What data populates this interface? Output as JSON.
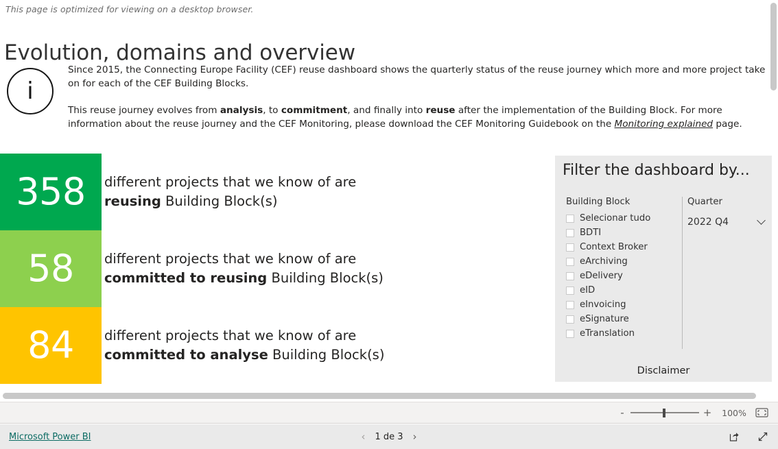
{
  "notice": "This page is optimized for viewing on a desktop browser.",
  "page_title": "Evolution, domains and overview",
  "info": {
    "icon": "info-circle-icon",
    "glyph": "i",
    "paragraph_1_a": "Since 2015, the Connecting Europe Facility (CEF) reuse dashboard shows the quarterly status of the reuse journey which more and more project take on for each of the CEF Building Blocks.",
    "paragraph_2_a": "This reuse journey evolves from ",
    "p2_bold_1": "analysis",
    "paragraph_2_b": ", to ",
    "p2_bold_2": "commitment",
    "paragraph_2_c": ", and finally into ",
    "p2_bold_3": "reuse",
    "paragraph_2_d": " after the implementation of the Building Block. For more information about the reuse journey and the CEF Monitoring, please download the CEF Monitoring Guidebook on the ",
    "link_text": "Monitoring explained",
    "paragraph_2_e": " page."
  },
  "kpis": [
    {
      "value": "358",
      "color": "#00A84F",
      "text_a": "different projects that we know of are",
      "text_bold": "reusing",
      "text_b": " Building Block(s)"
    },
    {
      "value": "58",
      "color": "#8DD04E",
      "text_a": "different projects that we know of are",
      "text_bold": "committed to reusing",
      "text_b": " Building Block(s)"
    },
    {
      "value": "84",
      "color": "#FFC400",
      "text_a": "different projects that we know of are",
      "text_bold": "committed to analyse",
      "text_b": " Building Block(s)"
    }
  ],
  "filter": {
    "title": "Filter the dashboard by...",
    "building_block_label": "Building Block",
    "building_blocks": [
      {
        "label": "Selecionar tudo",
        "checked": false
      },
      {
        "label": "BDTI",
        "checked": false
      },
      {
        "label": "Context Broker",
        "checked": false
      },
      {
        "label": "eArchiving",
        "checked": false
      },
      {
        "label": "eDelivery",
        "checked": false
      },
      {
        "label": "eID",
        "checked": false
      },
      {
        "label": "eInvoicing",
        "checked": false
      },
      {
        "label": "eSignature",
        "checked": false
      },
      {
        "label": "eTranslation",
        "checked": false
      }
    ],
    "quarter_label": "Quarter",
    "quarter_value": "2022 Q4",
    "disclaimer": "Disclaimer"
  },
  "zoombar": {
    "minus": "-",
    "plus": "+",
    "percent": "100%",
    "fit_icon": "fit-to-page-icon"
  },
  "footer": {
    "powerbi_link": "Microsoft Power BI",
    "prev_icon": "chevron-left-icon",
    "next_icon": "chevron-right-icon",
    "prev_glyph": "‹",
    "next_glyph": "›",
    "page_label": "1 de 3",
    "share_icon": "share-icon",
    "fullscreen_icon": "fullscreen-icon"
  }
}
